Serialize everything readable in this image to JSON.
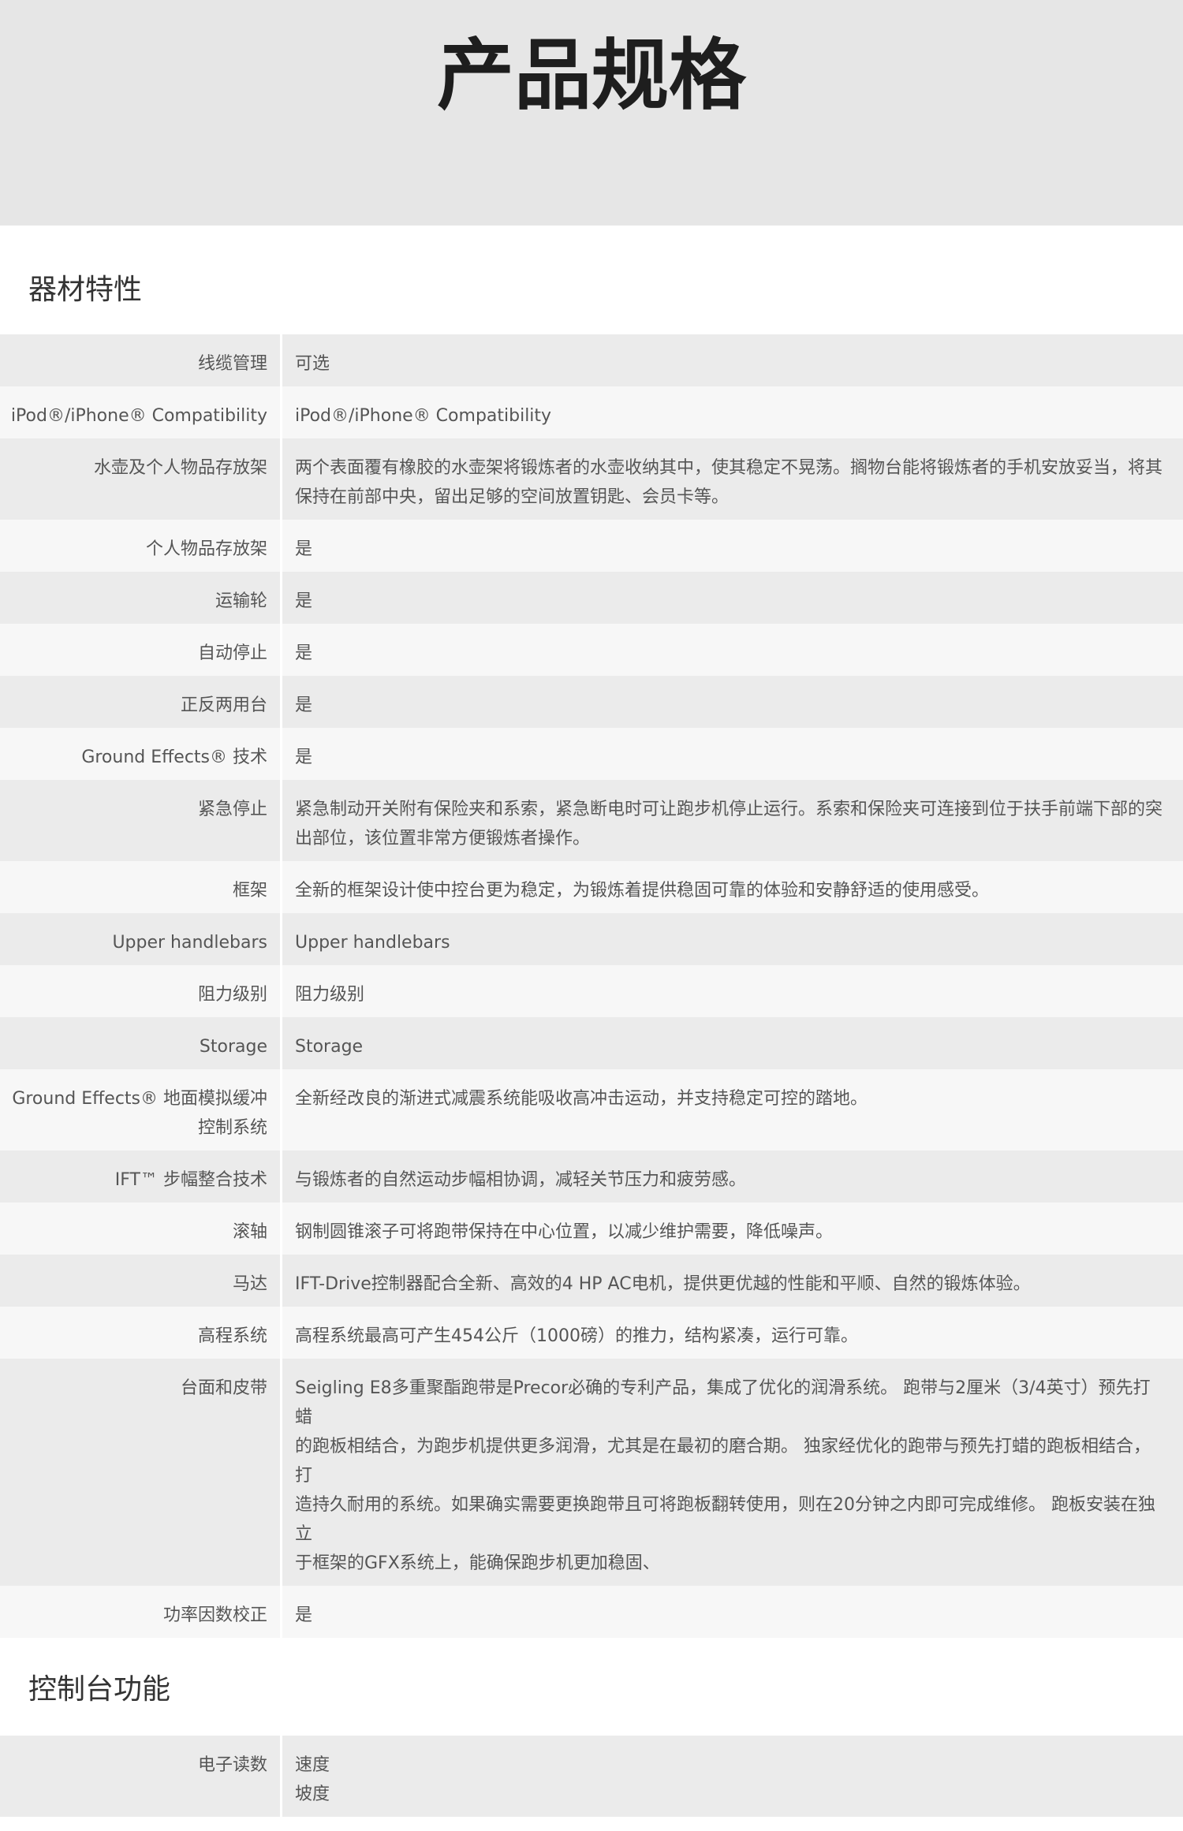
{
  "page": {
    "title": "产品规格"
  },
  "sections": [
    {
      "title": "器材特性",
      "rows": [
        {
          "label": "线缆管理",
          "value": [
            "可选"
          ]
        },
        {
          "label": "iPod®/iPhone® Compatibility",
          "value": [
            "iPod®/iPhone® Compatibility"
          ]
        },
        {
          "label": "水壶及个人物品存放架",
          "value": [
            "两个表面覆有橡胶的水壶架将锻炼者的水壶收纳其中，使其稳定不晃荡。搁物台能将锻炼者的手机安放妥当，将其",
            "保持在前部中央，留出足够的空间放置钥匙、会员卡等。"
          ]
        },
        {
          "label": "个人物品存放架",
          "value": [
            "是"
          ]
        },
        {
          "label": "运输轮",
          "value": [
            "是"
          ]
        },
        {
          "label": "自动停止",
          "value": [
            "是"
          ]
        },
        {
          "label": "正反两用台",
          "value": [
            "是"
          ]
        },
        {
          "label": "Ground Effects® 技术",
          "value": [
            "是"
          ]
        },
        {
          "label": "紧急停止",
          "value": [
            "紧急制动开关附有保险夹和系索，紧急断电时可让跑步机停止运行。系索和保险夹可连接到位于扶手前端下部的突",
            "出部位，该位置非常方便锻炼者操作。"
          ]
        },
        {
          "label": "框架",
          "value": [
            "全新的框架设计使中控台更为稳定，为锻炼着提供稳固可靠的体验和安静舒适的使用感受。"
          ]
        },
        {
          "label": "Upper handlebars",
          "value": [
            "Upper handlebars"
          ]
        },
        {
          "label": "阻力级别",
          "value": [
            "阻力级别"
          ]
        },
        {
          "label": "Storage",
          "value": [
            "Storage"
          ]
        },
        {
          "label": "Ground Effects® 地面模拟缓冲控制系统",
          "value": [
            "全新经改良的渐进式减震系统能吸收高冲击运动，并支持稳定可控的踏地。"
          ]
        },
        {
          "label": "IFT™ 步幅整合技术",
          "value": [
            "与锻炼者的自然运动步幅相协调，减轻关节压力和疲劳感。"
          ]
        },
        {
          "label": "滚轴",
          "value": [
            "钢制圆锥滚子可将跑带保持在中心位置，以减少维护需要，降低噪声。"
          ]
        },
        {
          "label": "马达",
          "value": [
            "IFT-Drive控制器配合全新、高效的4 HP AC电机，提供更优越的性能和平顺、自然的锻炼体验。"
          ]
        },
        {
          "label": "高程系统",
          "value": [
            "高程系统最高可产生454公斤（1000磅）的推力，结构紧凑，运行可靠。"
          ]
        },
        {
          "label": "台面和皮带",
          "value": [
            "Seigling E8多重聚酯跑带是Precor必确的专利产品，集成了优化的润滑系统。 跑带与2厘米（3/4英寸）预先打蜡",
            "的跑板相结合，为跑步机提供更多润滑，尤其是在最初的磨合期。 独家经优化的跑带与预先打蜡的跑板相结合，打",
            "造持久耐用的系统。如果确实需要更换跑带且可将跑板翻转使用，则在20分钟之内即可完成维修。 跑板安装在独立",
            "于框架的GFX系统上，能确保跑步机更加稳固、"
          ]
        },
        {
          "label": "功率因数校正",
          "value": [
            "是"
          ]
        }
      ]
    },
    {
      "title": "控制台功能",
      "rows": [
        {
          "label": "电子读数",
          "value": [
            "速度",
            "坡度"
          ]
        }
      ]
    }
  ]
}
